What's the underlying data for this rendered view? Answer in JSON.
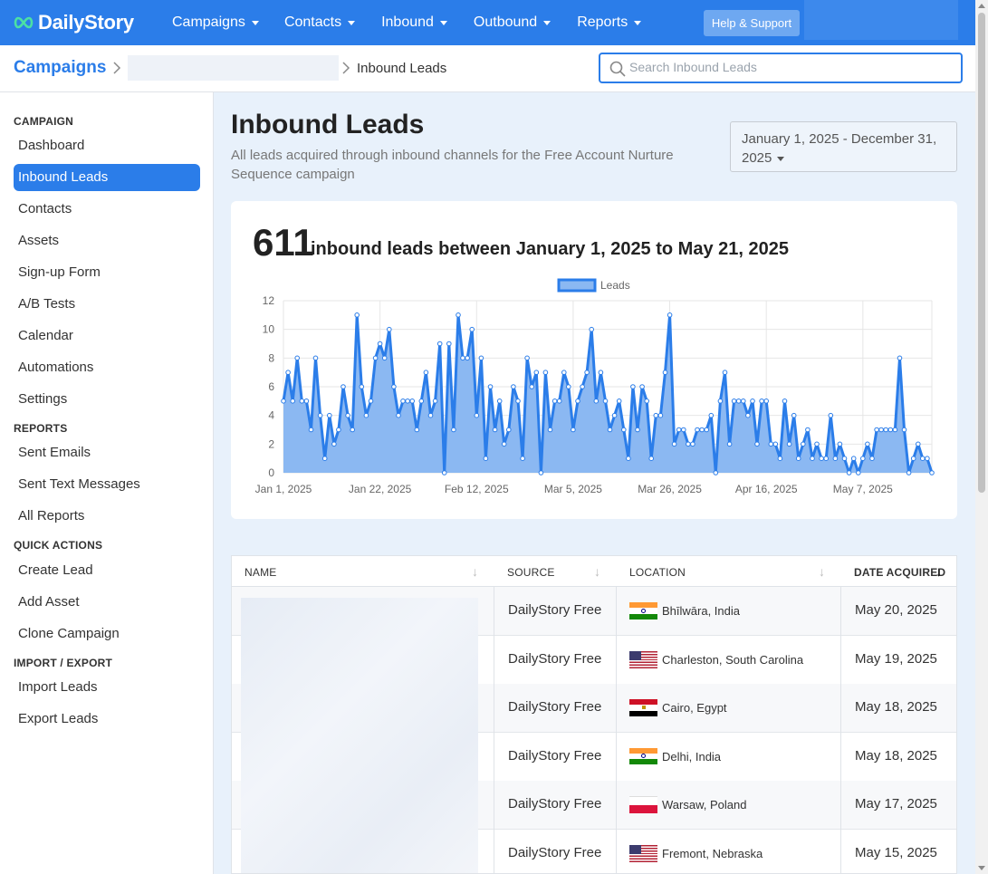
{
  "nav": {
    "logo": "DailyStory",
    "items": [
      "Campaigns",
      "Contacts",
      "Inbound",
      "Outbound",
      "Reports"
    ],
    "help": "Help & Support"
  },
  "breadcrumb": {
    "root": "Campaigns",
    "current": "Inbound Leads"
  },
  "search": {
    "placeholder": "Search Inbound Leads",
    "value": ""
  },
  "sidebar": {
    "sections": [
      {
        "title": "CAMPAIGN",
        "items": [
          "Dashboard",
          "Inbound Leads",
          "Contacts",
          "Assets",
          "Sign-up Form",
          "A/B Tests",
          "Calendar",
          "Automations",
          "Settings"
        ]
      },
      {
        "title": "REPORTS",
        "items": [
          "Sent Emails",
          "Sent Text Messages",
          "All Reports"
        ]
      },
      {
        "title": "QUICK ACTIONS",
        "items": [
          "Create Lead",
          "Add Asset",
          "Clone Campaign"
        ]
      },
      {
        "title": "IMPORT / EXPORT",
        "items": [
          "Import Leads",
          "Export Leads"
        ]
      }
    ],
    "active": "Inbound Leads"
  },
  "page": {
    "title": "Inbound Leads",
    "subtitle": "All leads acquired through inbound channels for the Free Account Nurture Sequence campaign",
    "date_range": "January 1, 2025 - December 31, 2025"
  },
  "summary": {
    "count": "611",
    "text": "inbound leads between January 1, 2025 to May 21, 2025"
  },
  "colors": {
    "accent": "#2b7de9",
    "chart_line": "#2b7de9",
    "chart_fill": "#8bb8f2"
  },
  "chart_data": {
    "type": "area",
    "legend": [
      "Leads"
    ],
    "legend_position": "top",
    "x_tick_labels": [
      "Jan 1, 2025",
      "Jan 22, 2025",
      "Feb 12, 2025",
      "Mar 5, 2025",
      "Mar 26, 2025",
      "Apr 16, 2025",
      "May 7, 2025"
    ],
    "y_ticks": [
      0,
      2,
      4,
      6,
      8,
      10,
      12
    ],
    "ylim": [
      0,
      12
    ],
    "x_start": "2025-01-01",
    "x_end": "2025-05-21",
    "grid": true,
    "series": [
      {
        "name": "Leads",
        "values": [
          5,
          7,
          5,
          8,
          5,
          5,
          3,
          8,
          4,
          1,
          4,
          2,
          3,
          6,
          4,
          3,
          11,
          6,
          4,
          5,
          8,
          9,
          8,
          10,
          6,
          4,
          5,
          5,
          5,
          3,
          5,
          7,
          4,
          5,
          9,
          0,
          9,
          3,
          11,
          8,
          8,
          10,
          4,
          8,
          1,
          6,
          3,
          5,
          2,
          3,
          6,
          5,
          1,
          8,
          6,
          7,
          0,
          7,
          3,
          5,
          5,
          7,
          6,
          3,
          5,
          6,
          7,
          10,
          5,
          7,
          5,
          3,
          4,
          5,
          3,
          1,
          6,
          3,
          6,
          5,
          1,
          4,
          4,
          7,
          11,
          2,
          3,
          3,
          2,
          2,
          3,
          3,
          3,
          4,
          0,
          5,
          7,
          2,
          5,
          5,
          5,
          4,
          5,
          2,
          5,
          5,
          2,
          2,
          1,
          5,
          2,
          4,
          1,
          2,
          3,
          1,
          2,
          1,
          1,
          4,
          1,
          2,
          1,
          0,
          1,
          0,
          1,
          2,
          1,
          3,
          3,
          3,
          3,
          3,
          8,
          3,
          0,
          1,
          2,
          1,
          1,
          0
        ]
      }
    ]
  },
  "table": {
    "columns": [
      "NAME",
      "SOURCE",
      "LOCATION",
      "DATE ACQUIRED"
    ],
    "rows": [
      {
        "source": "DailyStory Free",
        "location": "Bhīlwāra, India",
        "flag": "india",
        "date": "May 20, 2025"
      },
      {
        "source": "DailyStory Free",
        "location": "Charleston, South Carolina",
        "flag": "usa",
        "date": "May 19, 2025"
      },
      {
        "source": "DailyStory Free",
        "location": "Cairo, Egypt",
        "flag": "egypt",
        "date": "May 18, 2025"
      },
      {
        "source": "DailyStory Free",
        "location": "Delhi, India",
        "flag": "india",
        "date": "May 18, 2025"
      },
      {
        "source": "DailyStory Free",
        "location": "Warsaw, Poland",
        "flag": "poland",
        "date": "May 17, 2025"
      },
      {
        "source": "DailyStory Free",
        "location": "Fremont, Nebraska",
        "flag": "usa",
        "date": "May 15, 2025"
      }
    ]
  }
}
